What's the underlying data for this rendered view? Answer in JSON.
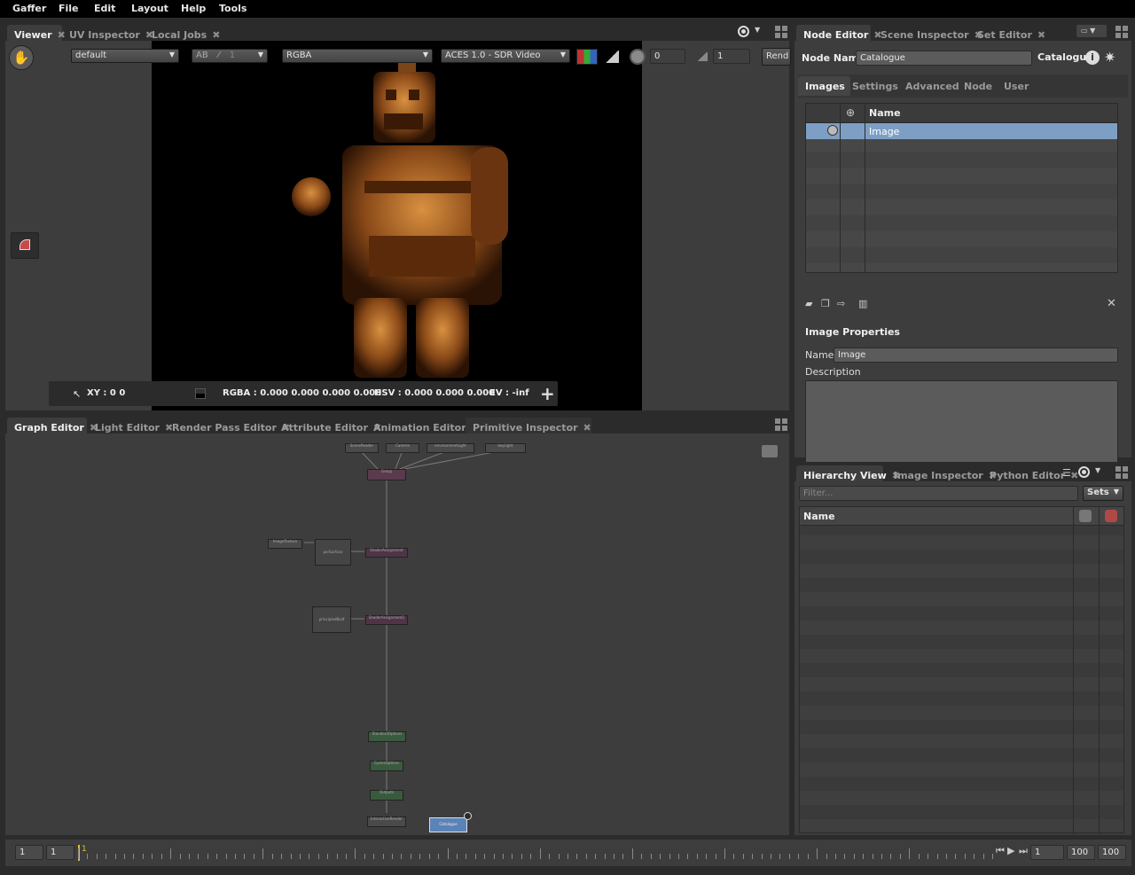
{
  "menu": {
    "gaffer": "Gaffer",
    "file": "File",
    "edit": "Edit",
    "layout": "Layout",
    "help": "Help",
    "tools": "Tools"
  },
  "viewer_tabs": {
    "viewer": "Viewer",
    "uv_inspector": "UV Inspector",
    "local_jobs": "Local Jobs",
    "close": "✖"
  },
  "viewer_toolbar": {
    "camera": "default",
    "ab": "AB",
    "channel_mode": "RGBA",
    "display_transform": "ACES 1.0 - SDR Video",
    "exposure": "0",
    "gamma": "1",
    "render_button": "Rend",
    "wipe_value": "1"
  },
  "viewer_status": {
    "xy": "XY : 0 0",
    "rgba": "RGBA : 0.000 0.000 0.000 0.000",
    "hsv": "HSV : 0.000 0.000 0.000",
    "ev": "EV : -inf"
  },
  "node_editor_tabs": {
    "node_editor": "Node Editor",
    "scene_inspector": "Scene Inspector",
    "set_editor": "Set Editor"
  },
  "node_editor": {
    "node_name_label": "Node Name",
    "node_name": "Catalogue",
    "node_type": "Catalogue",
    "subtabs": [
      "Images",
      "Settings",
      "Advanced",
      "Node",
      "User"
    ],
    "column_name": "Name",
    "images": [
      {
        "name": "Image",
        "selected": true
      }
    ],
    "image_properties": "Image Properties",
    "name_label": "Name",
    "name_value": "Image",
    "description_label": "Description"
  },
  "graph_tabs": {
    "graph_editor": "Graph Editor",
    "light_editor": "Light Editor",
    "render_pass_editor": "Render Pass Editor",
    "attribute_editor": "Attribute Editor",
    "animation_editor": "Animation Editor",
    "primitive_inspector": "Primitive Inspector"
  },
  "graph_nodes": {
    "reference": "SceneReader",
    "camera": "Camera",
    "env_light": "environmentLight",
    "key_light": "keyLight",
    "group": "Group",
    "image_texture": "ImageTexture",
    "pxr_surface": "pxrSurface",
    "shader_assign1": "ShaderAssignment",
    "principled": "principledBsdf",
    "shader_assign2": "ShaderAssignment1",
    "standard_options": "StandardOptions",
    "cycles_options": "CyclesOptions",
    "outputs": "Outputs",
    "interactive_render": "InteractiveRender",
    "catalogue": "Catalogue"
  },
  "hierarchy_tabs": {
    "hierarchy_view": "Hierarchy View",
    "image_inspector": "Image Inspector",
    "python_editor": "Python Editor"
  },
  "hierarchy": {
    "filter_placeholder": "Filter...",
    "sets": "Sets",
    "column_name": "Name"
  },
  "timeline": {
    "start": "1",
    "current_start": "1",
    "playhead_label": "1",
    "frame": "1",
    "end": "100",
    "range_end": "100"
  },
  "colors": {
    "selection": "#7e9fc4",
    "catalogue_node": "#5b83b8",
    "group_node": "#5a3a4c",
    "shader_node": "#4f3447",
    "option_node": "#3a5a3e"
  }
}
